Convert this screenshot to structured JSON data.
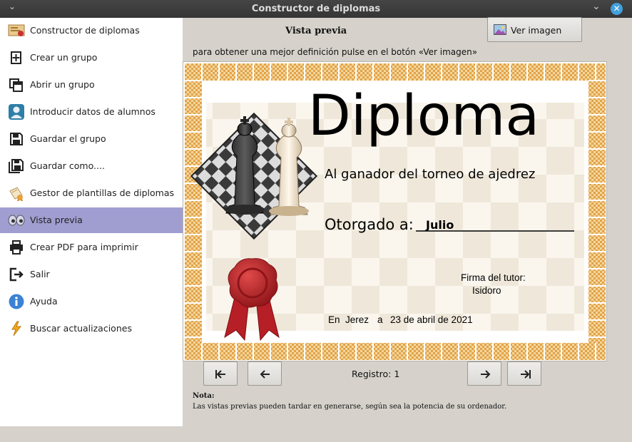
{
  "window": {
    "title": "Constructor de diplomas",
    "close_glyph": "✕",
    "min_glyph": "⌄",
    "menu_glyph": "⌄"
  },
  "sidebar": {
    "items": [
      {
        "label": "Constructor de diplomas",
        "icon": "certificate-icon"
      },
      {
        "label": "Crear un grupo",
        "icon": "new-file-icon"
      },
      {
        "label": "Abrir un grupo",
        "icon": "open-group-icon"
      },
      {
        "label": "Introducir datos de alumnos",
        "icon": "user-icon"
      },
      {
        "label": "Guardar el grupo",
        "icon": "save-icon"
      },
      {
        "label": "Guardar como....",
        "icon": "save-as-icon"
      },
      {
        "label": "Gestor de plantillas de diplomas",
        "icon": "template-manager-icon"
      },
      {
        "label": "Vista previa",
        "icon": "eyes-icon"
      },
      {
        "label": "Crear PDF para imprimir",
        "icon": "printer-icon"
      },
      {
        "label": "Salir",
        "icon": "exit-icon"
      },
      {
        "label": "Ayuda",
        "icon": "info-icon"
      },
      {
        "label": "Buscar actualizaciones",
        "icon": "lightning-icon"
      }
    ],
    "active_index": 7,
    "active_color": "#a09ed0"
  },
  "preview": {
    "title": "Vista previa",
    "view_image_button": "Ver imagen",
    "hint": "para obtener una mejor definición pulse en el botón «Ver imagen»"
  },
  "certificate": {
    "heading": "Diploma",
    "subtitle": "Al ganador del torneo de ajedrez",
    "awarded_label": "Otorgado a:",
    "recipient": "Julio",
    "signature_label": "Firma del tutor:",
    "tutor": "Isidoro",
    "place_prefix": "En",
    "city": "Jerez",
    "date_prefix": "a",
    "date": "23 de abril de 2021",
    "border_color": "#d99a3c",
    "seal_color": "#b21e22"
  },
  "navigation": {
    "first_icon": "first-record-icon",
    "prev_icon": "prev-record-icon",
    "next_icon": "next-record-icon",
    "last_icon": "last-record-icon",
    "record_label": "Registro: 1"
  },
  "note": {
    "title": "Nota:",
    "text": "Las vistas previas pueden tardar en generarse, según sea la potencia de su ordenador."
  }
}
